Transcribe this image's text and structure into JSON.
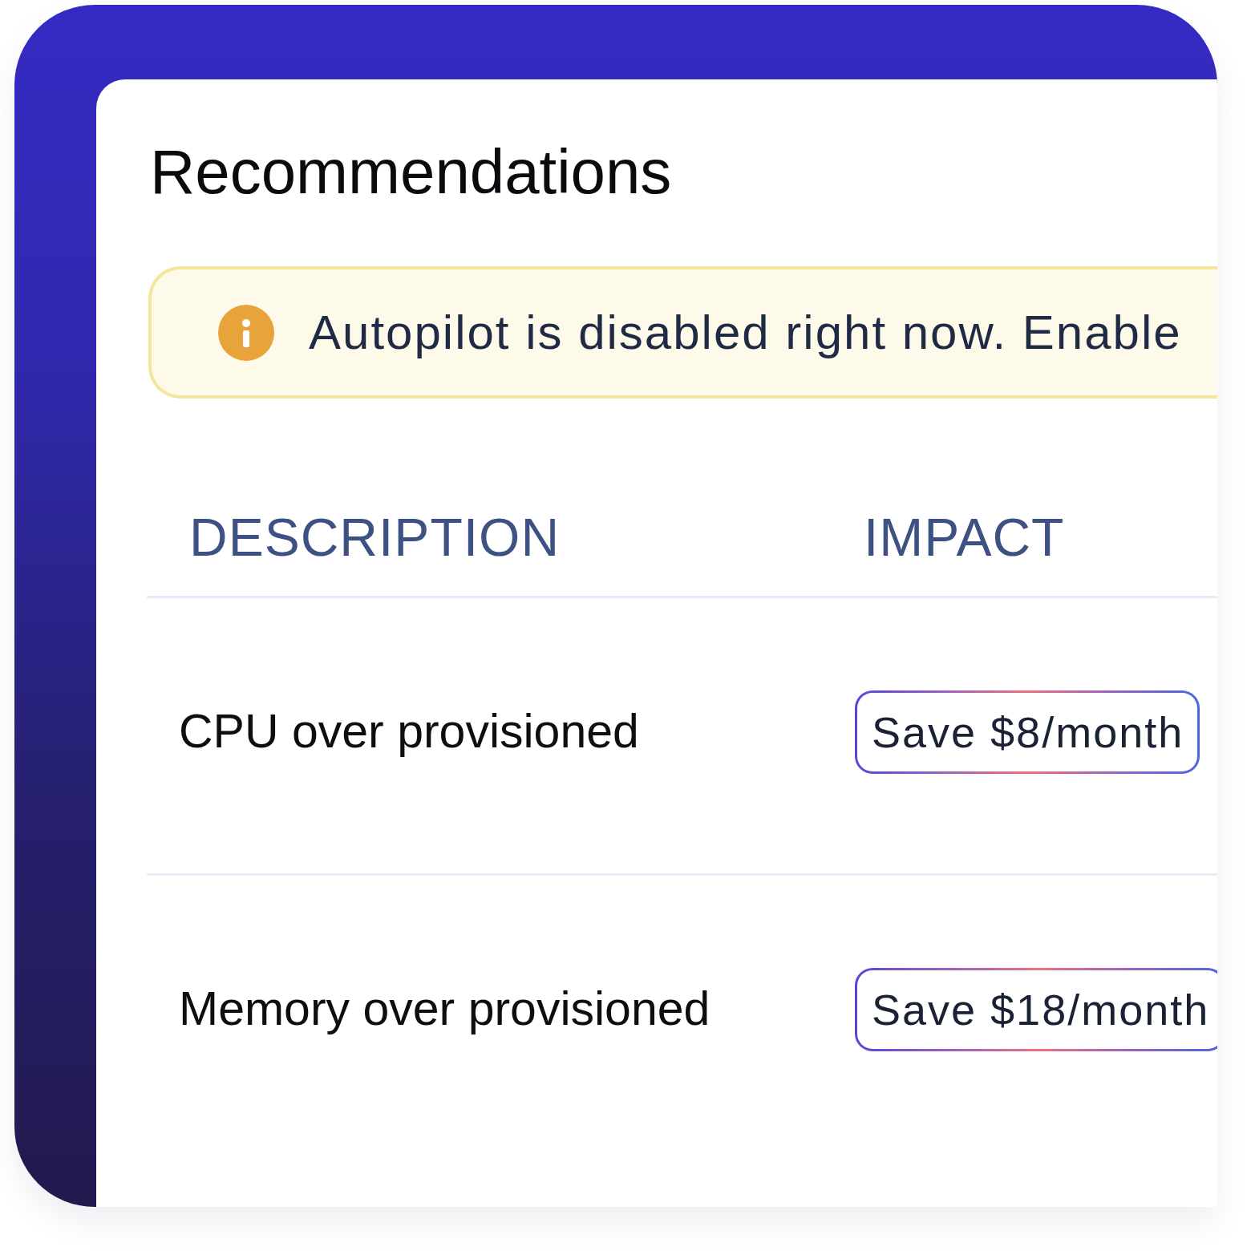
{
  "title": "Recommendations",
  "banner": {
    "kind": "warning",
    "text": "Autopilot is disabled right now. Enable"
  },
  "table": {
    "columns": [
      "DESCRIPTION",
      "IMPACT"
    ],
    "rows": [
      {
        "description": "CPU over provisioned",
        "impact": "Save $8/month"
      },
      {
        "description": "Memory over provisioned",
        "impact": "Save $18/month"
      }
    ]
  }
}
